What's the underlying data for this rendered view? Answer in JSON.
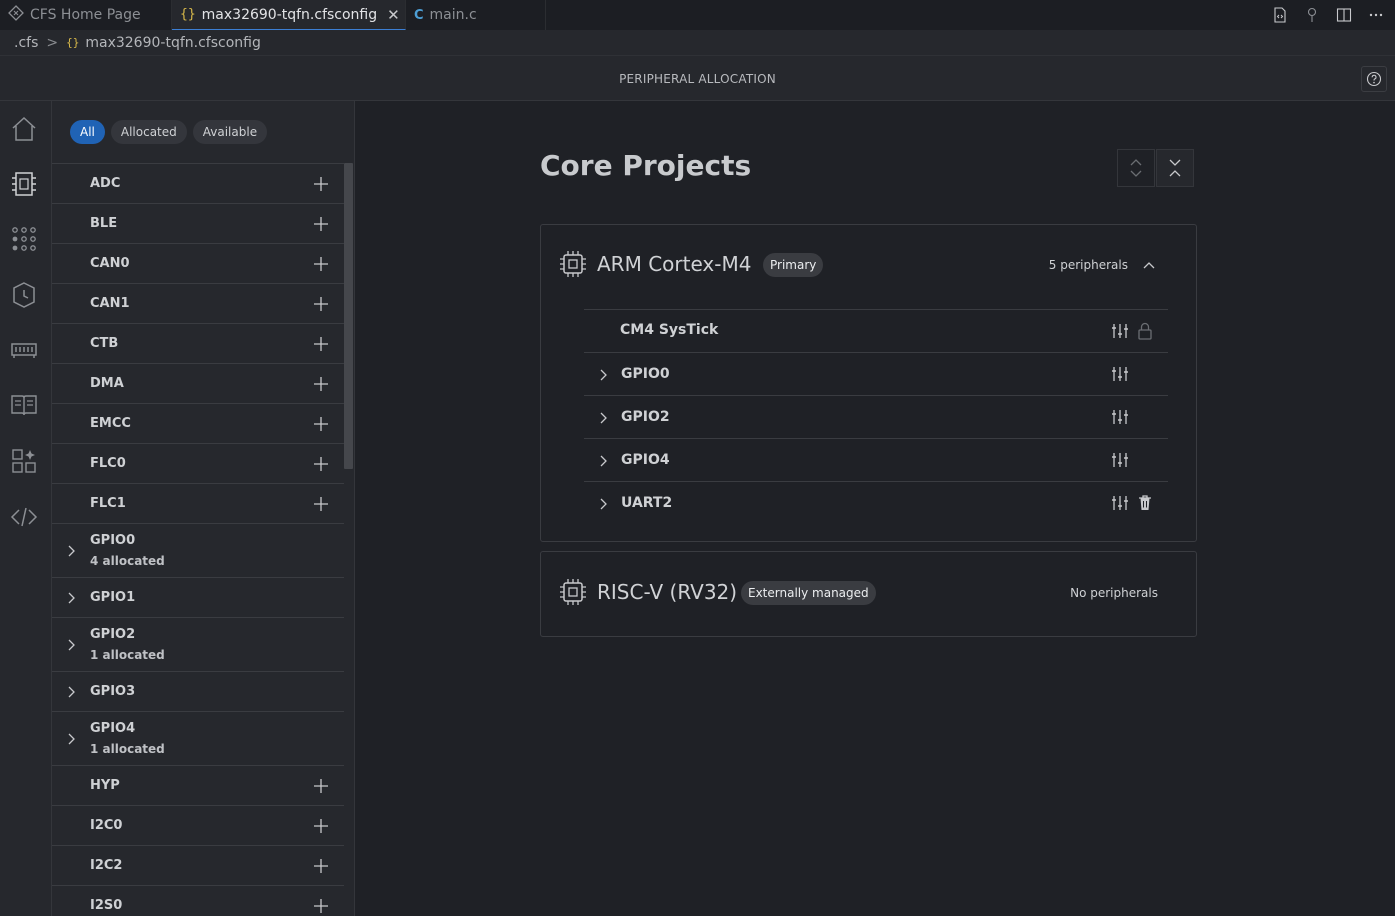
{
  "tabs": [
    {
      "label": "CFS Home Page",
      "icon": "cfs-home-icon"
    },
    {
      "label": "max32690-tqfn.cfsconfig",
      "icon": "json-braces-icon",
      "glyph": "{}",
      "active": true
    },
    {
      "label": "main.c",
      "icon": "c-file-icon",
      "glyph": "C"
    }
  ],
  "breadcrumb": {
    "folder": ".cfs",
    "separator": ">",
    "glyph": "{}",
    "file": "max32690-tqfn.cfsconfig"
  },
  "page_title": "PERIPHERAL ALLOCATION",
  "filters": [
    "All",
    "Allocated",
    "Available"
  ],
  "peripherals": [
    {
      "name": "ADC"
    },
    {
      "name": "BLE"
    },
    {
      "name": "CAN0"
    },
    {
      "name": "CAN1"
    },
    {
      "name": "CTB"
    },
    {
      "name": "DMA"
    },
    {
      "name": "EMCC"
    },
    {
      "name": "FLC0"
    },
    {
      "name": "FLC1"
    },
    {
      "name": "GPIO0",
      "sub": "4 allocated"
    },
    {
      "name": "GPIO1",
      "expandable": true
    },
    {
      "name": "GPIO2",
      "sub": "1 allocated"
    },
    {
      "name": "GPIO3",
      "expandable": true
    },
    {
      "name": "GPIO4",
      "sub": "1 allocated"
    },
    {
      "name": "HYP"
    },
    {
      "name": "I2C0"
    },
    {
      "name": "I2C2"
    },
    {
      "name": "I2S0"
    }
  ],
  "main": {
    "title": "Core Projects",
    "cores": [
      {
        "name": "ARM Cortex-M4",
        "badge": "Primary",
        "count": "5 peripherals",
        "items": [
          {
            "name": "CM4 SysTick",
            "action": "lock"
          },
          {
            "name": "GPIO0"
          },
          {
            "name": "GPIO2"
          },
          {
            "name": "GPIO4"
          },
          {
            "name": "UART2",
            "action": "delete"
          }
        ]
      },
      {
        "name": "RISC-V (RV32)",
        "badge": "Externally managed",
        "count": "No peripherals"
      }
    ]
  },
  "colors": {
    "accent": "#2063b5",
    "background": "#1f2126",
    "panel": "#26282d"
  }
}
